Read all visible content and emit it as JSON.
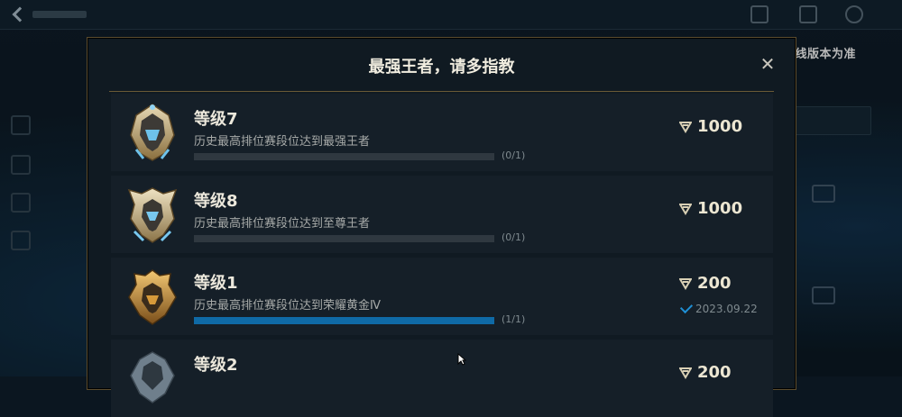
{
  "watermark": "开发版本录制，实际效果以上线版本为准",
  "modal": {
    "title": "最强王者，请多指教",
    "close_glyph": "✕"
  },
  "quests": [
    {
      "title": "等级7",
      "description": "历史最高排位赛段位达到最强王者",
      "progress": "(0/1)",
      "progress_fraction": 0,
      "reward": "1000",
      "emblem": "challenger-crest-icon",
      "completed_date": ""
    },
    {
      "title": "等级8",
      "description": "历史最高排位赛段位达到至尊王者",
      "progress": "(0/1)",
      "progress_fraction": 0,
      "reward": "1000",
      "emblem": "supreme-crest-icon",
      "completed_date": ""
    },
    {
      "title": "等级1",
      "description": "历史最高排位赛段位达到荣耀黄金Ⅳ",
      "progress": "(1/1)",
      "progress_fraction": 1,
      "reward": "200",
      "emblem": "gold-crest-icon",
      "completed_date": "2023.09.22"
    },
    {
      "title": "等级2",
      "reward": "200",
      "emblem": "platinum-crest-icon"
    }
  ],
  "colors": {
    "accent_gold": "#6a5a36",
    "progress_blue": "#0f6aa6",
    "check_blue": "#1f8fd4"
  }
}
